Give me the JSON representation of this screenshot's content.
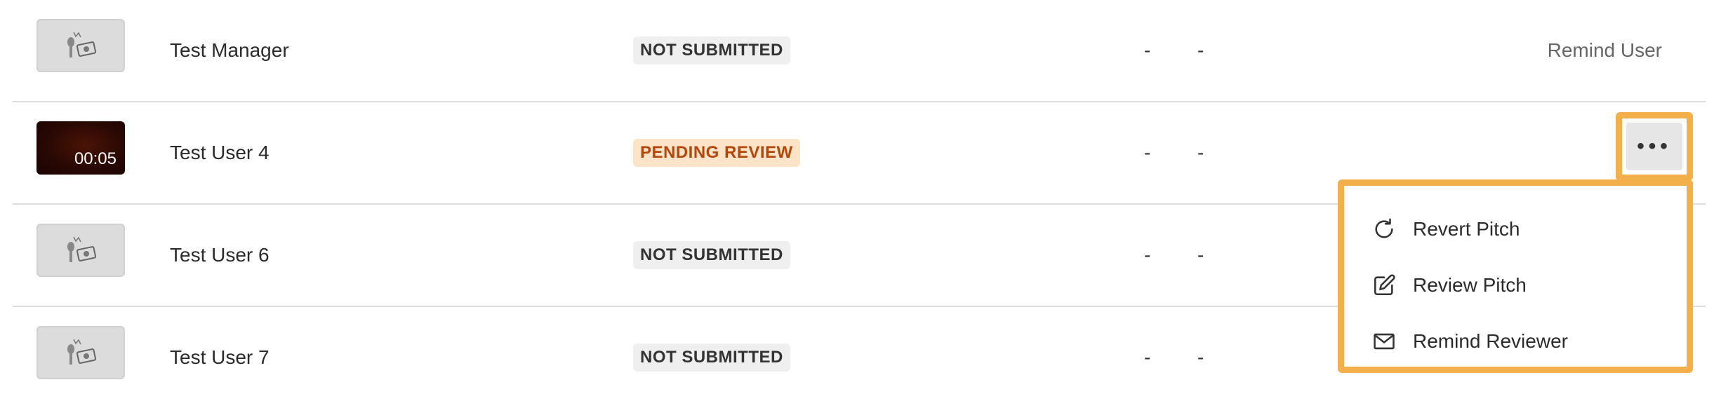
{
  "rows": [
    {
      "name": "Test Manager",
      "status": "NOT SUBMITTED",
      "col1": "-",
      "col2": "-",
      "action": "Remind User"
    },
    {
      "name": "Test User 4",
      "status": "PENDING REVIEW",
      "col1": "-",
      "col2": "-",
      "duration": "00:05"
    },
    {
      "name": "Test User 6",
      "status": "NOT SUBMITTED",
      "col1": "-",
      "col2": "-"
    },
    {
      "name": "Test User 7",
      "status": "NOT SUBMITTED",
      "col1": "-",
      "col2": "-"
    }
  ],
  "more_button": {
    "label": "•••",
    "icon": "more-horizontal-icon"
  },
  "menu": {
    "items": [
      {
        "label": "Revert Pitch",
        "icon": "rotate-icon"
      },
      {
        "label": "Review Pitch",
        "icon": "edit-icon"
      },
      {
        "label": "Remind Reviewer",
        "icon": "mail-icon"
      }
    ]
  },
  "colors": {
    "highlight": "#f3b04a",
    "pending_bg": "#fde3c8",
    "pending_text": "#b3470c",
    "not_submitted_bg": "#efefef"
  }
}
